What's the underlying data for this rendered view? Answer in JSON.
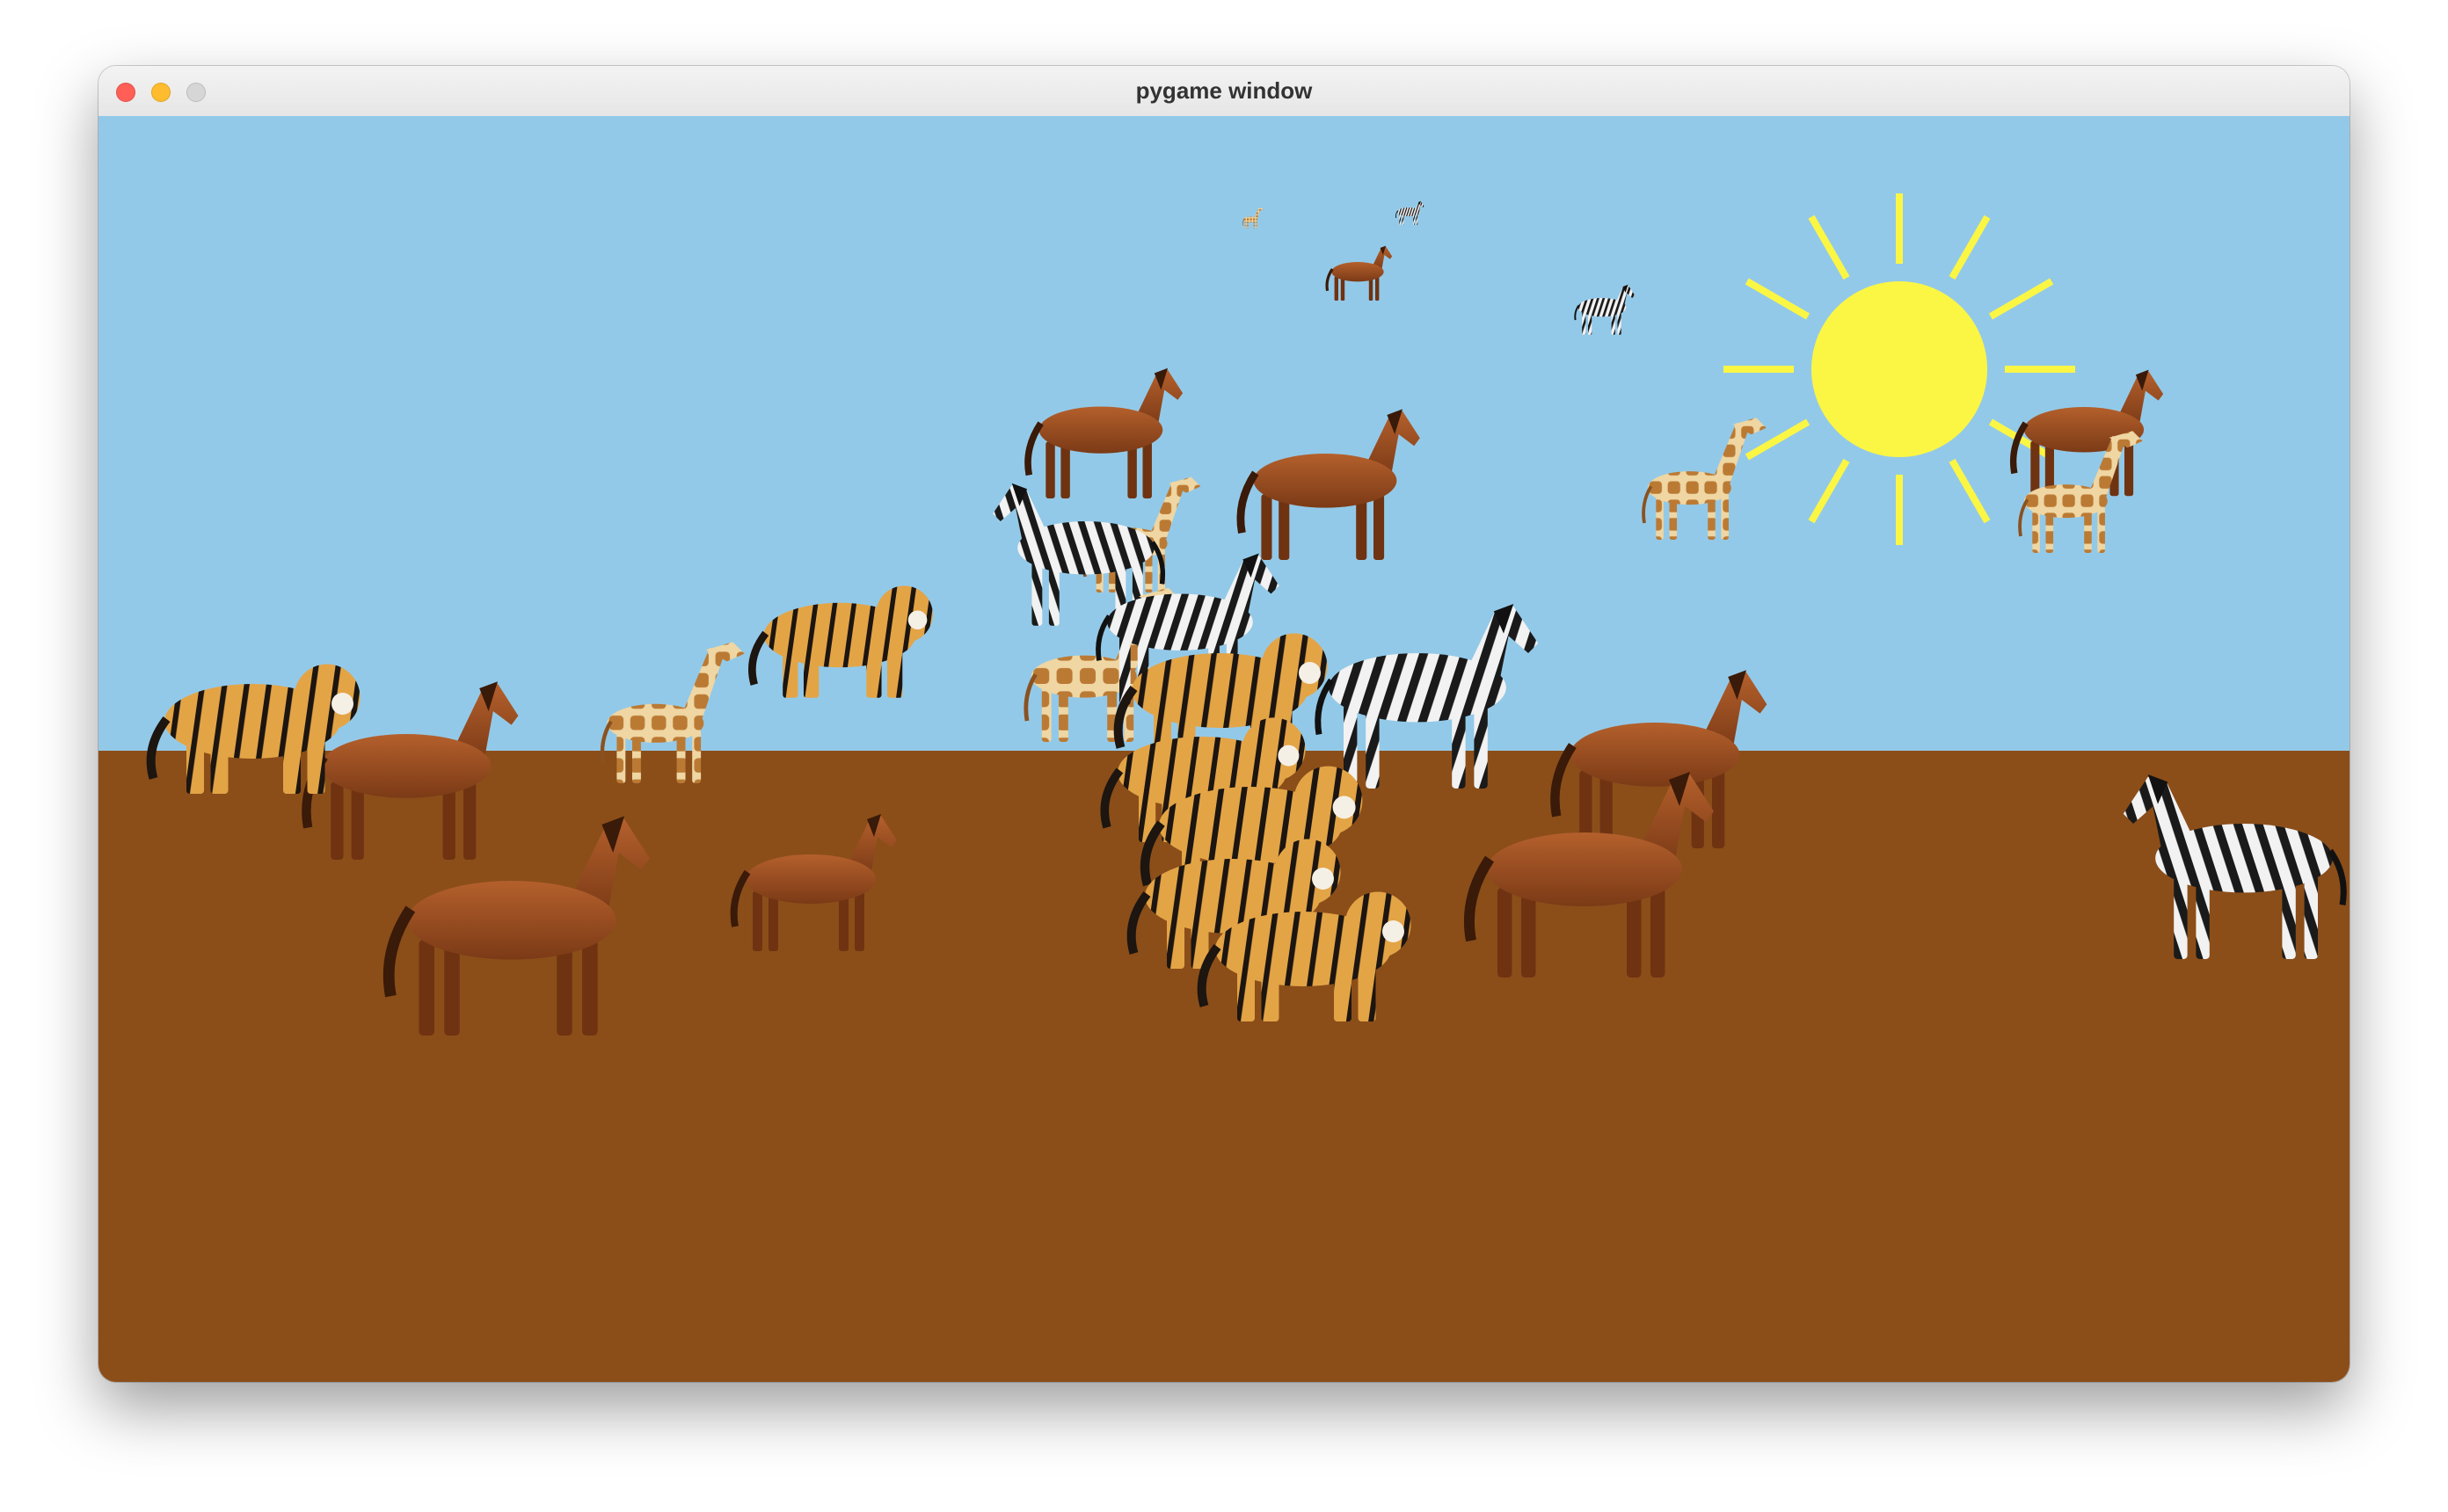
{
  "window": {
    "title": "pygame window",
    "controls": {
      "close_color": "#ff5f57",
      "minimize_color": "#febc2e",
      "zoom_color": "#d6d6d6"
    }
  },
  "scene": {
    "sky_color": "#93c9e8",
    "ground_color": "#8b4e19",
    "sun_color": "#fbf644",
    "animal_colors": {
      "horse": "#9a4d22",
      "zebra": "#222222",
      "giraffe": "#c98f45",
      "tiger": "#e0a040"
    },
    "sprites": [
      {
        "kind": "giraffe",
        "icon": "giraffe-icon"
      },
      {
        "kind": "zebra",
        "icon": "zebra-icon"
      },
      {
        "kind": "horse",
        "icon": "horse-icon"
      },
      {
        "kind": "zebra",
        "icon": "zebra-icon"
      },
      {
        "kind": "horse",
        "icon": "horse-icon"
      },
      {
        "kind": "horse",
        "icon": "horse-icon"
      },
      {
        "kind": "giraffe",
        "icon": "giraffe-icon"
      },
      {
        "kind": "horse",
        "icon": "horse-icon"
      },
      {
        "kind": "giraffe",
        "icon": "giraffe-icon"
      },
      {
        "kind": "giraffe",
        "icon": "giraffe-icon"
      },
      {
        "kind": "zebra",
        "icon": "zebra-icon"
      },
      {
        "kind": "giraffe",
        "icon": "giraffe-icon"
      },
      {
        "kind": "zebra",
        "icon": "zebra-icon"
      },
      {
        "kind": "tiger",
        "icon": "tiger-icon"
      },
      {
        "kind": "zebra",
        "icon": "zebra-icon"
      },
      {
        "kind": "horse",
        "icon": "horse-icon"
      },
      {
        "kind": "giraffe",
        "icon": "giraffe-icon"
      },
      {
        "kind": "tiger",
        "icon": "tiger-icon"
      },
      {
        "kind": "tiger",
        "icon": "tiger-icon"
      },
      {
        "kind": "tiger",
        "icon": "tiger-icon"
      },
      {
        "kind": "tiger",
        "icon": "tiger-icon"
      },
      {
        "kind": "tiger",
        "icon": "tiger-icon"
      },
      {
        "kind": "tiger",
        "icon": "tiger-icon"
      },
      {
        "kind": "horse",
        "icon": "horse-icon"
      },
      {
        "kind": "horse",
        "icon": "horse-icon"
      },
      {
        "kind": "horse",
        "icon": "horse-icon"
      },
      {
        "kind": "horse",
        "icon": "horse-icon"
      },
      {
        "kind": "zebra",
        "icon": "zebra-icon"
      }
    ]
  }
}
